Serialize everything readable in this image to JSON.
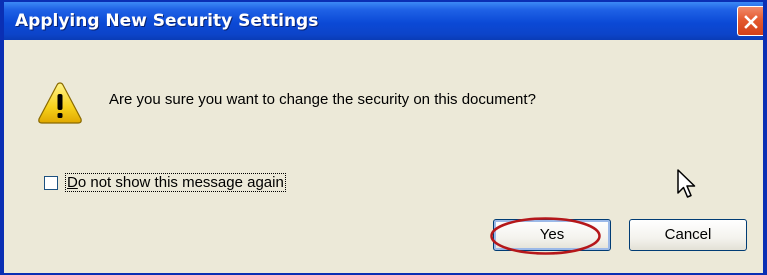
{
  "dialog": {
    "title": "Applying New Security Settings",
    "message": "Are you sure you want to change the security on this document?",
    "icon": "warning-icon",
    "checkbox": {
      "label_first_letter": "D",
      "label_rest": "o not show this message again",
      "checked": false
    },
    "buttons": {
      "yes_label": "Yes",
      "cancel_label": "Cancel"
    }
  },
  "colors": {
    "titlebar": "#0b49d6",
    "client_bg": "#ece9d8",
    "close_button": "#e45a30",
    "highlight": "#b5171a"
  }
}
